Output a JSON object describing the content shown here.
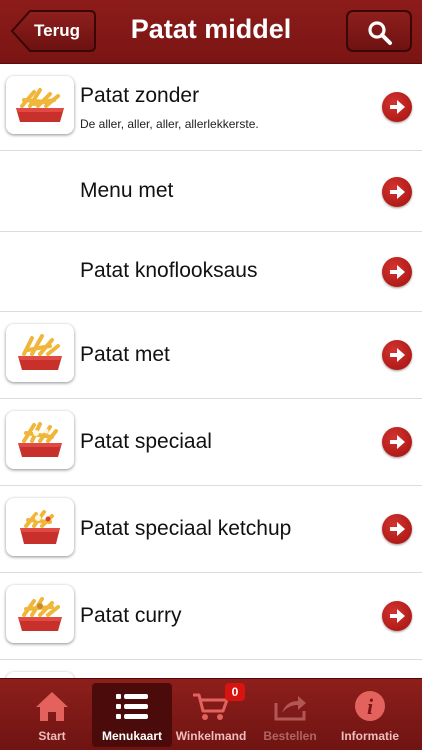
{
  "navbar": {
    "back_label": "Terug",
    "title": "Patat middel",
    "search_icon": "search-icon"
  },
  "list": {
    "items": [
      {
        "title": "Patat zonder",
        "subtitle": "De aller, aller, aller, allerlekkerste.",
        "has_image": true
      },
      {
        "title": "Menu met",
        "subtitle": "",
        "has_image": false
      },
      {
        "title": "Patat knoflooksaus",
        "subtitle": "",
        "has_image": false
      },
      {
        "title": "Patat met",
        "subtitle": "",
        "has_image": true
      },
      {
        "title": "Patat speciaal",
        "subtitle": "",
        "has_image": true
      },
      {
        "title": "Patat speciaal ketchup",
        "subtitle": "",
        "has_image": true
      },
      {
        "title": "Patat curry",
        "subtitle": "",
        "has_image": true
      }
    ]
  },
  "tabbar": {
    "tabs": [
      {
        "label": "Start",
        "icon": "home-icon",
        "state": "normal"
      },
      {
        "label": "Menukaart",
        "icon": "list-icon",
        "state": "active"
      },
      {
        "label": "Winkelmand",
        "icon": "cart-icon",
        "state": "normal",
        "badge": "0"
      },
      {
        "label": "Bestellen",
        "icon": "share-icon",
        "state": "disabled"
      },
      {
        "label": "Informatie",
        "icon": "info-icon",
        "state": "normal"
      }
    ]
  },
  "colors": {
    "brand_red": "#7a1514",
    "arrow_red": "#c0231f",
    "badge_red": "#d7140f"
  }
}
